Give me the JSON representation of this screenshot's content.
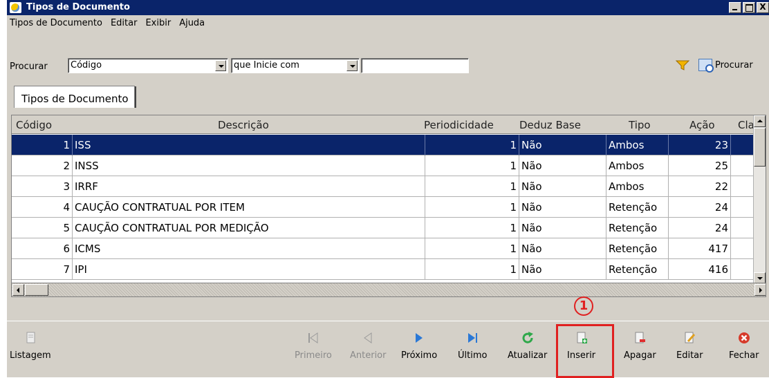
{
  "window": {
    "title": "Tipos de Documento",
    "window_buttons": [
      "_",
      "□",
      "X"
    ]
  },
  "menu": {
    "items": [
      {
        "label": "Tipos de Documento"
      },
      {
        "label": "Editar"
      },
      {
        "label": "Exibir"
      },
      {
        "label": "Ajuda"
      }
    ]
  },
  "search": {
    "label": "Procurar",
    "field_value": "Código",
    "operator_value": "que Inicie com",
    "text_value": "",
    "button_label": "Procurar"
  },
  "tab": {
    "label": "Tipos de Documento"
  },
  "grid": {
    "columns": [
      "Código",
      "Descrição",
      "Periodicidade",
      "Deduz Base",
      "Tipo",
      "Ação",
      "Cla"
    ],
    "rows": [
      {
        "codigo": "1",
        "descricao": "ISS",
        "periodicidade": "1",
        "deduz": "Não",
        "tipo": "Ambos",
        "acao": "23"
      },
      {
        "codigo": "2",
        "descricao": "INSS",
        "periodicidade": "1",
        "deduz": "Não",
        "tipo": "Ambos",
        "acao": "25"
      },
      {
        "codigo": "3",
        "descricao": "IRRF",
        "periodicidade": "1",
        "deduz": "Não",
        "tipo": "Ambos",
        "acao": "22"
      },
      {
        "codigo": "4",
        "descricao": "CAUÇÃO CONTRATUAL POR ITEM",
        "periodicidade": "1",
        "deduz": "Não",
        "tipo": "Retenção",
        "acao": "24"
      },
      {
        "codigo": "5",
        "descricao": "CAUÇÃO CONTRATUAL POR MEDIÇÃO",
        "periodicidade": "1",
        "deduz": "Não",
        "tipo": "Retenção",
        "acao": "24"
      },
      {
        "codigo": "6",
        "descricao": "ICMS",
        "periodicidade": "1",
        "deduz": "Não",
        "tipo": "Retenção",
        "acao": "417"
      },
      {
        "codigo": "7",
        "descricao": "IPI",
        "periodicidade": "1",
        "deduz": "Não",
        "tipo": "Retenção",
        "acao": "416"
      }
    ],
    "selected_row": 0
  },
  "toolbar": {
    "listagem": "Listagem",
    "primeiro": "Primeiro",
    "anterior": "Anterior",
    "proximo": "Próximo",
    "ultimo": "Último",
    "atualizar": "Atualizar",
    "inserir": "Inserir",
    "apagar": "Apagar",
    "editar": "Editar",
    "fechar": "Fechar",
    "callout": "1"
  },
  "colors": {
    "title_bar": "#0a246a",
    "selection": "#0a246a",
    "window_bg": "#d4d0c8",
    "highlight": "#e02020"
  },
  "icons": {
    "listagem": "document-icon",
    "primeiro": "first-record-icon",
    "anterior": "previous-record-icon",
    "proximo": "next-record-icon",
    "ultimo": "last-record-icon",
    "atualizar": "refresh-icon",
    "inserir": "insert-document-icon",
    "apagar": "delete-document-icon",
    "editar": "edit-document-icon",
    "fechar": "close-icon",
    "filter": "filter-icon",
    "procurar": "search-document-icon"
  }
}
